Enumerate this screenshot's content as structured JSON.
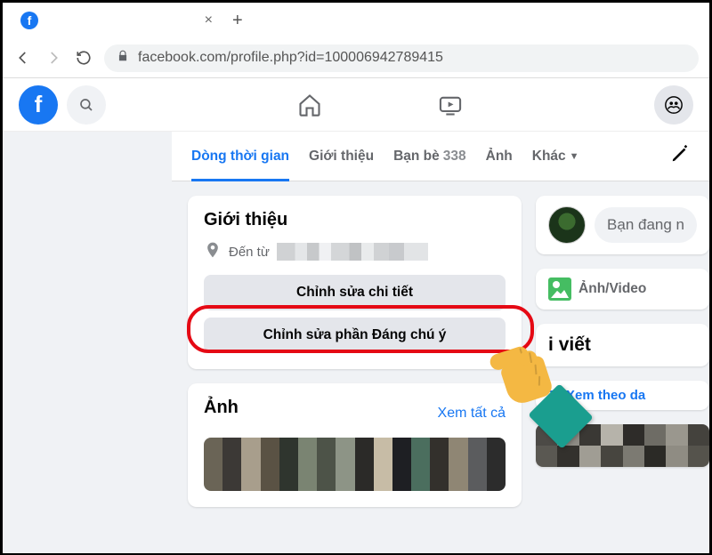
{
  "browser": {
    "tab_title": "",
    "url": "facebook.com/profile.php?id=100006942789415"
  },
  "profile_tabs": {
    "timeline": "Dòng thời gian",
    "about": "Giới thiệu",
    "friends": "Bạn bè",
    "friends_count": "338",
    "photos": "Ảnh",
    "more": "Khác"
  },
  "intro": {
    "heading": "Giới thiệu",
    "from_label": "Đến từ",
    "edit_details": "Chỉnh sửa chi tiết",
    "edit_featured": "Chỉnh sửa phần Đáng chú ý"
  },
  "photos": {
    "heading": "Ảnh",
    "see_all": "Xem tất cả"
  },
  "composer": {
    "placeholder": "Bạn đang n",
    "media_label": "Ảnh/Video"
  },
  "posts": {
    "heading": "i viết",
    "filter": "Xem theo da"
  }
}
